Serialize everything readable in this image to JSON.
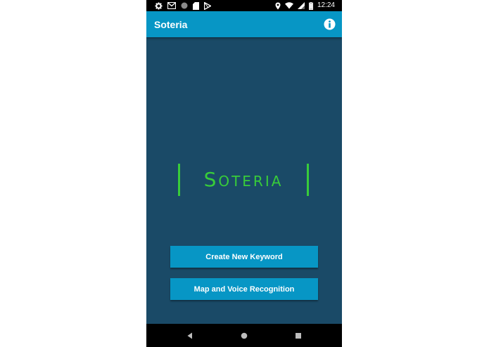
{
  "status_bar": {
    "time": "12:24",
    "left_icons": [
      "settings-icon",
      "gmail-icon",
      "circle-icon",
      "sd-card-icon",
      "play-store-icon"
    ],
    "right_icons": [
      "location-icon",
      "wifi-icon",
      "signal-icon",
      "battery-icon"
    ]
  },
  "app_bar": {
    "title": "Soteria",
    "action_icon": "info-icon"
  },
  "logo": {
    "text": "Soteria",
    "color": "#38cc3a"
  },
  "buttons": {
    "create_keyword": "Create New Keyword",
    "map_voice": "Map and Voice Recognition"
  },
  "nav_bar": {
    "icons": [
      "back-icon",
      "home-icon",
      "recents-icon"
    ]
  },
  "colors": {
    "background": "#1a4a67",
    "accent": "#0796c5",
    "logo_green": "#38cc3a"
  }
}
